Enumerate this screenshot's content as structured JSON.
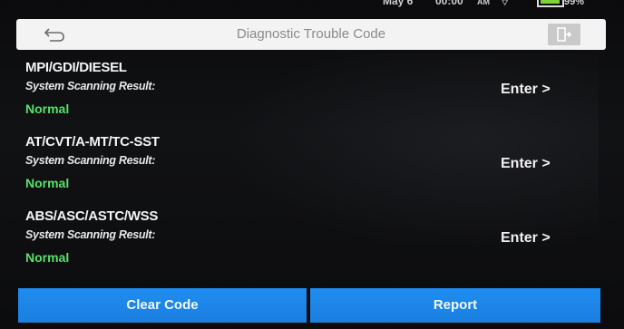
{
  "status_bar": {
    "date": "May 6",
    "time": "00:00",
    "ampm": "AM",
    "battery_text": "99%"
  },
  "header": {
    "title": "Diagnostic Trouble Code",
    "back_icon": "back-arrow-icon",
    "exit_icon": "exit-door-icon"
  },
  "systems": [
    {
      "name": "MPI/GDI/DIESEL",
      "label": "System Scanning Result:",
      "status": "Normal",
      "action": "Enter >"
    },
    {
      "name": "AT/CVT/A-MT/TC-SST",
      "label": "System Scanning Result:",
      "status": "Normal",
      "action": "Enter >"
    },
    {
      "name": "ABS/ASC/ASTC/WSS",
      "label": "System Scanning Result:",
      "status": "Normal",
      "action": "Enter >"
    }
  ],
  "footer": {
    "clear_label": "Clear Code",
    "report_label": "Report"
  },
  "colors": {
    "status_ok": "#57e06a",
    "button_blue": "#1a7fe0",
    "header_bg": "#f3f3f3"
  }
}
